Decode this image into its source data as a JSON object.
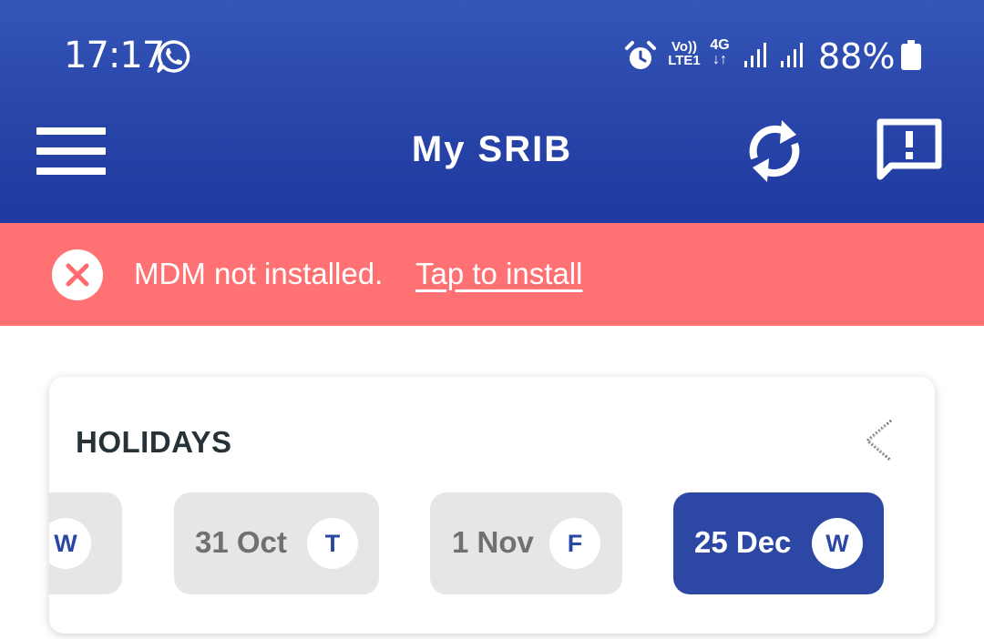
{
  "status_bar": {
    "time": "17:17",
    "volte_line1": "Vo))",
    "volte_line2": "LTE1",
    "network": "4G",
    "network_arrows": "↓↑",
    "battery": "88%",
    "icons": [
      "whatsapp-icon",
      "alarm-icon",
      "signal-icon",
      "battery-icon"
    ]
  },
  "app_bar": {
    "title": "My SRIB",
    "icons": [
      "menu-icon",
      "sync-icon",
      "feedback-icon"
    ],
    "color": "#1f3aa0"
  },
  "banner": {
    "message": "MDM not installed.",
    "link": "Tap to install",
    "color": "#ff7173",
    "icon": "error-close-icon"
  },
  "holidays": {
    "title": "HOLIDAYS",
    "collapse_icon": "chevron-left-icon",
    "items": [
      {
        "label": "",
        "day": "W"
      },
      {
        "label": "31 Oct",
        "day": "T"
      },
      {
        "label": "1 Nov",
        "day": "F"
      },
      {
        "label": "25 Dec",
        "day": "W",
        "active": true
      }
    ],
    "active_color": "#2d48a4"
  }
}
